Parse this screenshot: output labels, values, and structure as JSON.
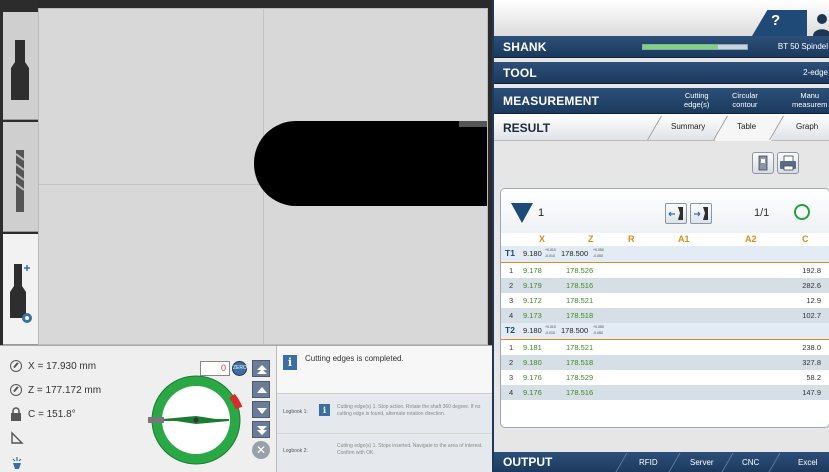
{
  "coords": {
    "x": "X = 17.930 mm",
    "z": "Z = 177.172 mm",
    "c": "C = 151.8°"
  },
  "dial": {
    "angle_value": "0",
    "mode_label": "ZERO"
  },
  "messages": {
    "main": "Cutting edges is completed.",
    "log": [
      {
        "label": "Logbook 1:",
        "text": "Cutting edge(s) 1. Stop action. Rotate the shaft 360 degree. If no cutting edge is found, alternate rotation direction."
      },
      {
        "label": "Logbook 2:",
        "text": "Cutting edge(s) 1. Stops inserted. Navigate to the area of interest. Confirm with OK."
      }
    ]
  },
  "shank": {
    "title": "SHANK",
    "value": "BT 50 Spindel",
    "progress": 0.72
  },
  "tool": {
    "title": "TOOL",
    "value": "2-edge"
  },
  "measurement": {
    "title": "MEASUREMENT",
    "tabs": [
      {
        "line1": "Cutting",
        "line2": "edge(s)"
      },
      {
        "line1": "Circular",
        "line2": "contour"
      },
      {
        "line1": "Manu",
        "line2": "measurem"
      }
    ]
  },
  "result": {
    "title": "RESULT",
    "tabs": [
      "Summary",
      "Table",
      "Graph"
    ],
    "active_tab": "Table"
  },
  "card": {
    "number": "1",
    "page": "1/1",
    "columns": [
      "X",
      "Z",
      "R",
      "A1",
      "A2",
      "C"
    ]
  },
  "table": {
    "groups": [
      {
        "id": "T1",
        "x": "9.180",
        "x_tol_plus": "+0.010",
        "x_tol_minus": "-0.010",
        "z": "178.500",
        "z_tol_plus": "+0.050",
        "z_tol_minus": "-0.050",
        "rows": [
          {
            "i": "1",
            "x": "9.178",
            "z": "178.526",
            "c": "192.8"
          },
          {
            "i": "2",
            "x": "9.179",
            "z": "178.516",
            "c": "282.6"
          },
          {
            "i": "3",
            "x": "9.172",
            "z": "178.521",
            "c": "12.9"
          },
          {
            "i": "4",
            "x": "9.173",
            "z": "178.518",
            "c": "102.7"
          }
        ]
      },
      {
        "id": "T2",
        "x": "9.180",
        "x_tol_plus": "+0.010",
        "x_tol_minus": "-0.010",
        "z": "178.500",
        "z_tol_plus": "+0.050",
        "z_tol_minus": "-0.050",
        "rows": [
          {
            "i": "1",
            "x": "9.181",
            "z": "178.521",
            "c": "238.0"
          },
          {
            "i": "2",
            "x": "9.180",
            "z": "178.518",
            "c": "327.8"
          },
          {
            "i": "3",
            "x": "9.176",
            "z": "178.529",
            "c": "58.2"
          },
          {
            "i": "4",
            "x": "9.176",
            "z": "178.516",
            "c": "147.9"
          }
        ]
      }
    ]
  },
  "output": {
    "title": "OUTPUT",
    "tabs": [
      "RFID",
      "Server",
      "CNC",
      "Excel"
    ]
  },
  "help": {
    "label": "?"
  },
  "colors": {
    "navy": "#1f4a77",
    "accent_orange": "#e08a1e",
    "value_green": "#3d8a22",
    "ok_green": "#1fa33b"
  }
}
